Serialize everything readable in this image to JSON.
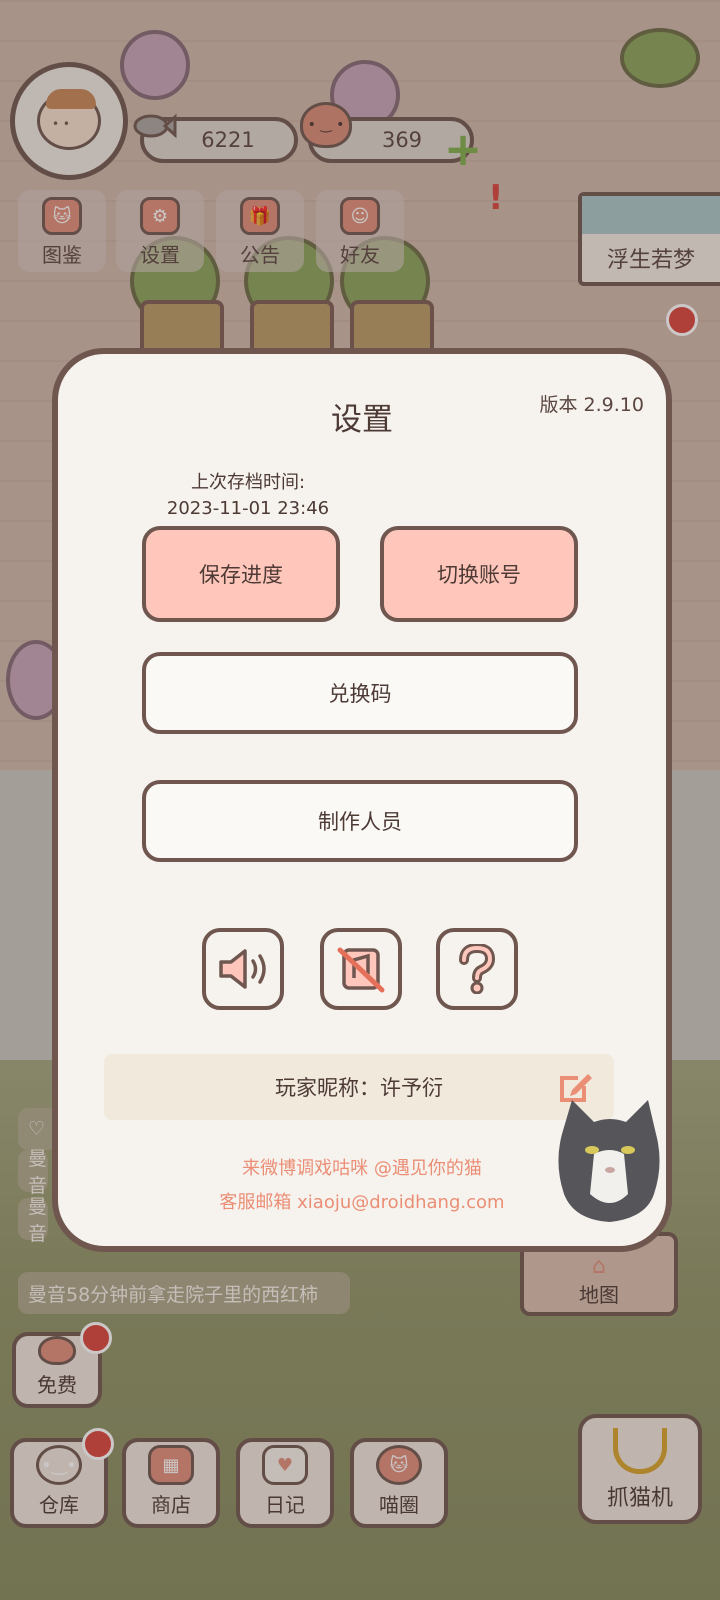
{
  "hud": {
    "fish_count": "6221",
    "heart_count": "369"
  },
  "menu": [
    {
      "label": "图鉴",
      "icon": "cat-book-icon"
    },
    {
      "label": "设置",
      "icon": "gear-icon"
    },
    {
      "label": "公告",
      "icon": "gift-icon"
    },
    {
      "label": "好友",
      "icon": "friends-icon"
    }
  ],
  "banner": {
    "label": "浮生若梦"
  },
  "settings": {
    "title": "设置",
    "version": "版本 2.9.10",
    "last_save_label": "上次存档时间:",
    "last_save_time": "2023-11-01 23:46",
    "save_button": "保存进度",
    "switch_account_button": "切换账号",
    "redeem_button": "兑换码",
    "credits_button": "制作人员",
    "toggles": [
      "speaker-icon",
      "music-off-icon",
      "question-icon"
    ],
    "nickname": "玩家昵称：许予衍",
    "footer_weibo": "来微博调戏咕咪 @遇见你的猫",
    "footer_email": "客服邮箱 xiaoju@droidhang.com"
  },
  "notices": [
    "曼音",
    "曼音",
    "曼音58分钟前拿走院子里的西红柿"
  ],
  "bottom": {
    "free": "免费",
    "warehouse": "仓库",
    "shop": "商店",
    "diary": "日记",
    "circle": "喵圈",
    "map": "地图",
    "claw_machine": "抓猫机"
  },
  "colors": {
    "accent_pink": "#ffc7bc",
    "text_link": "#eb8e76",
    "outline": "#6f5750",
    "badge_red": "#d9433c"
  }
}
